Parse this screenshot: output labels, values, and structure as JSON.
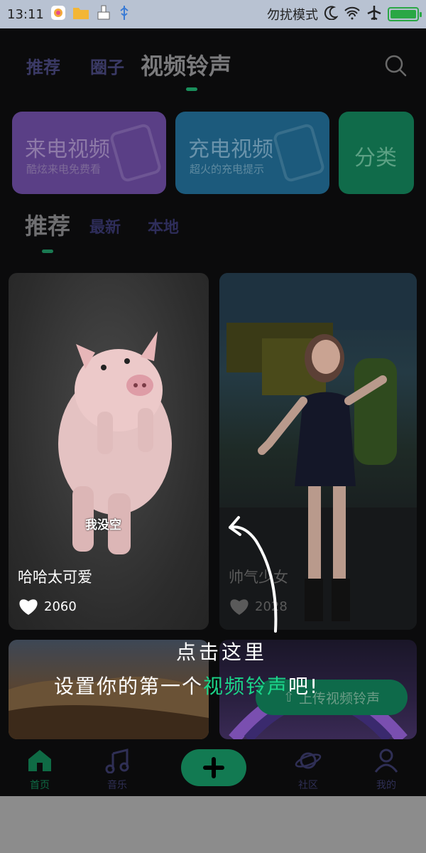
{
  "status": {
    "time": "13:11",
    "mode": "勿扰模式"
  },
  "header": {
    "tabs": [
      "推荐",
      "圈子",
      "视频铃声"
    ],
    "active_index": 2
  },
  "banners": [
    {
      "title": "来电视频",
      "subtitle": "酷炫来电免费看"
    },
    {
      "title": "充电视频",
      "subtitle": "超火的充电提示"
    },
    {
      "title": "分类"
    }
  ],
  "subtabs": [
    "推荐",
    "最新",
    "本地"
  ],
  "cards": [
    {
      "title": "哈哈太可爱",
      "likes": "2060",
      "caption": "我没空"
    },
    {
      "title": "帅气少女",
      "likes": "2028"
    }
  ],
  "upload_button": "上传视频铃声",
  "hint": {
    "line1": "点击这里",
    "line2_pre": "设置你的第一个",
    "line2_highlight": "视频铃声",
    "line2_post": "吧!"
  },
  "nav": {
    "items": [
      "首页",
      "音乐",
      "社区",
      "我的"
    ]
  },
  "colors": {
    "accent": "#1bd68a",
    "brand_green": "#127a52",
    "purple": "#5a3f86",
    "blue": "#1c5a7c"
  }
}
